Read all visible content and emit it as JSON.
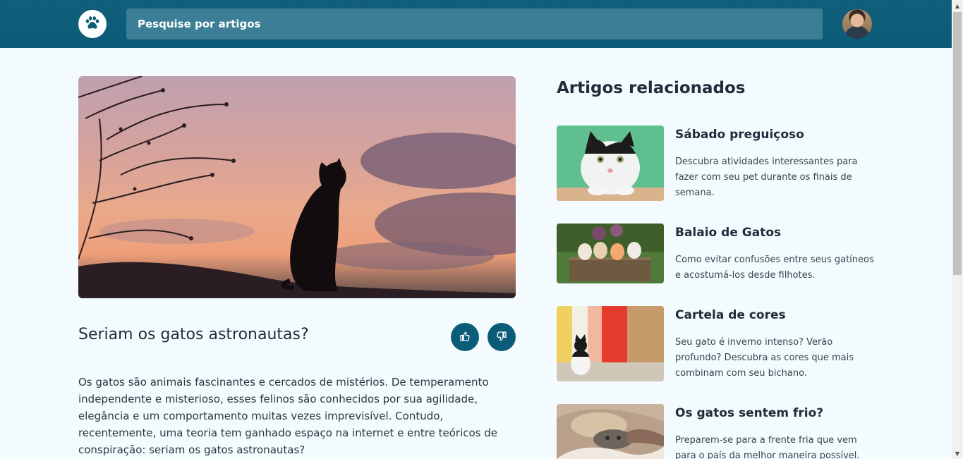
{
  "header": {
    "logo_icon": "paw-icon",
    "search_placeholder": "Pesquise por artigos",
    "avatar_icon": "user-avatar"
  },
  "article": {
    "title": "Seriam os gatos astronautas?",
    "body": "Os gatos são animais fascinantes e cercados de mistérios. De temperamento independente e misterioso, esses felinos são conhecidos por sua agilidade, elegância e um comportamento muitas vezes imprevisível. Contudo, recentemente, uma teoria tem ganhado espaço na internet e entre teóricos de conspiração: seriam os gatos astronautas?",
    "like_icon": "thumbs-up-icon",
    "dislike_icon": "thumbs-down-icon"
  },
  "related": {
    "heading": "Artigos relacionados",
    "items": [
      {
        "title": "Sábado preguiçoso",
        "description": "Descubra atividades interessantes para fazer com seu pet durante os finais de semana."
      },
      {
        "title": "Balaio de Gatos",
        "description": "Como evitar confusões entre seus gatíneos e acostumá-los desde filhotes."
      },
      {
        "title": "Cartela de cores",
        "description": "Seu gato é inverno intenso? Verão profundo? Descubra as cores que mais combinam com seu bichano."
      },
      {
        "title": "Os gatos sentem frio?",
        "description": "Preparem-se para a frente fria que vem para o país da melhor maneira possível."
      }
    ]
  },
  "colors": {
    "primary": "#0b5c78",
    "search_bg": "#3b7e96",
    "page_bg": "#f4fbfe"
  }
}
